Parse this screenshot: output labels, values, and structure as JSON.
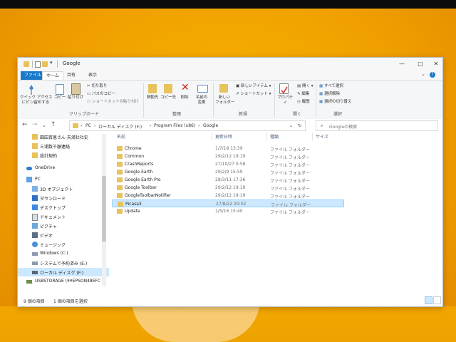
{
  "window": {
    "title": "Google",
    "controls": {
      "minimize": "—",
      "maximize": "□",
      "close": "✕"
    }
  },
  "ribbon_tabs": [
    "ファイル",
    "ホーム",
    "共有",
    "表示"
  ],
  "ribbon": {
    "clipboard": {
      "quick_access": "クイック アクセス\nにピン留めする",
      "copy": "コピー",
      "paste": "貼り付け",
      "cut": "切り取り",
      "copy_path": "パスのコピー",
      "paste_shortcut": "ショートカットの貼り付け",
      "label": "クリップボード"
    },
    "organize": {
      "move_to": "移動先",
      "copy_to": "コピー先",
      "delete": "削除",
      "rename": "名前の\n変更",
      "label": "整理"
    },
    "new": {
      "new_folder": "新しい\nフォルダー",
      "new_item": "新しいアイテム ▾",
      "shortcut": "ショートカット ▾",
      "label": "新規"
    },
    "open": {
      "properties": "プロパティ",
      "open": "開く ▾",
      "edit": "編集",
      "history": "履歴",
      "label": "開く"
    },
    "select": {
      "select_all": "すべて選択",
      "select_none": "選択解除",
      "invert": "選択の切り替え",
      "label": "選択"
    }
  },
  "address": {
    "crumbs": [
      "PC",
      "ローカル ディスク (F:)",
      "Program Files (x86)",
      "Google"
    ],
    "search_placeholder": "Googleの検索"
  },
  "sidebar": [
    {
      "label": "園田百恵さん 天満社社史",
      "icon": "folder-icon"
    },
    {
      "label": "三浦数千額連絡",
      "icon": "folder-icon"
    },
    {
      "label": "設計契約",
      "icon": "folder-icon"
    },
    {
      "label": "OneDrive",
      "icon": "cloud-icon"
    },
    {
      "label": "PC",
      "icon": "pc-icon"
    },
    {
      "label": "3D オブジェクト",
      "icon": "cube-icon"
    },
    {
      "label": "ダウンロード",
      "icon": "download-icon"
    },
    {
      "label": "デスクトップ",
      "icon": "desktop-icon"
    },
    {
      "label": "ドキュメント",
      "icon": "document-icon"
    },
    {
      "label": "ピクチャ",
      "icon": "picture-icon"
    },
    {
      "label": "ビデオ",
      "icon": "video-icon"
    },
    {
      "label": "ミュージック",
      "icon": "music-icon"
    },
    {
      "label": "Windows (C:)",
      "icon": "drive-icon"
    },
    {
      "label": "システムで予約済み (E:)",
      "icon": "drive-icon"
    },
    {
      "label": "ローカル ディスク (F:)",
      "icon": "drive-icon"
    },
    {
      "label": "USBSTORAGE (¥¥EPSON48EFC",
      "icon": "network-drive-icon"
    }
  ],
  "columns": {
    "name": "名前",
    "date": "更新日時",
    "type": "種類",
    "size": "サイズ"
  },
  "files": [
    {
      "name": "Chrome",
      "date": "1/7/18 13:39",
      "type": "ファイル フォルダー"
    },
    {
      "name": "Common",
      "date": "29/2/12 19:19",
      "type": "ファイル フォルダー"
    },
    {
      "name": "CrashReports",
      "date": "27/10/27 0:58",
      "type": "ファイル フォルダー"
    },
    {
      "name": "Google Earth",
      "date": "29/2/9 15:59",
      "type": "ファイル フォルダー"
    },
    {
      "name": "Google Earth Pro",
      "date": "28/3/11 17:36",
      "type": "ファイル フォルダー"
    },
    {
      "name": "Google Toolbar",
      "date": "29/2/12 19:19",
      "type": "ファイル フォルダー"
    },
    {
      "name": "GoogleToolbarNotifier",
      "date": "29/2/12 19:19",
      "type": "ファイル フォルダー"
    },
    {
      "name": "Picasa3",
      "date": "27/8/22 20:02",
      "type": "ファイル フォルダー"
    },
    {
      "name": "Update",
      "date": "1/5/16 15:40",
      "type": "ファイル フォルダー"
    }
  ],
  "status": {
    "count": "9 個の項目",
    "selected": "1 個の項目を選択"
  }
}
